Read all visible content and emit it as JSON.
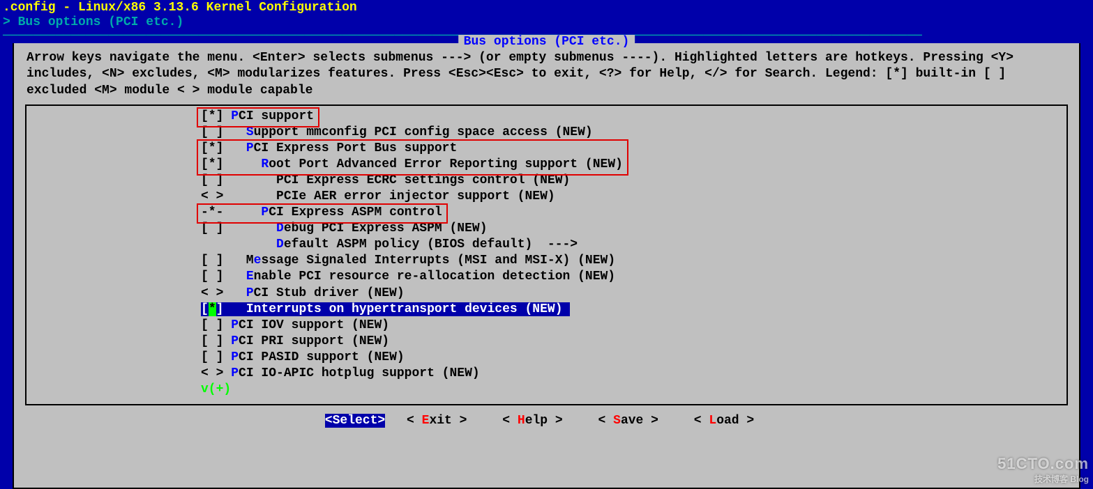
{
  "title": ".config - Linux/x86 3.13.6 Kernel Configuration",
  "breadcrumb_prefix": "> ",
  "breadcrumb": "Bus options (PCI etc.)",
  "panel_title": "Bus options (PCI etc.)",
  "help": "Arrow keys navigate the menu.  <Enter> selects submenus ---> (or empty submenus ----).  Highlighted letters are hotkeys.  Pressing <Y> includes, <N> excludes, <M> modularizes features.  Press <Esc><Esc> to exit, <?> for Help, </> for Search.  Legend: [*] built-in  [ ] excluded  <M> module  < > module capable",
  "items": [
    {
      "indent": 0,
      "marker": "[*]",
      "hotkey": "P",
      "before": "",
      "after": "CI support",
      "highlight": false,
      "box": "a"
    },
    {
      "indent": 0,
      "marker": "[ ]",
      "hotkey": "S",
      "before": "  ",
      "after": "upport mmconfig PCI config space access (NEW)",
      "highlight": false,
      "box": null
    },
    {
      "indent": 0,
      "marker": "[*]",
      "hotkey": "P",
      "before": "  ",
      "after": "CI Express Port Bus support",
      "highlight": false,
      "box": "b"
    },
    {
      "indent": 0,
      "marker": "[*]",
      "hotkey": "R",
      "before": "    ",
      "after": "oot Port Advanced Error Reporting support (NEW)",
      "highlight": false,
      "box": "b"
    },
    {
      "indent": 0,
      "marker": "[ ]",
      "hotkey": "",
      "before": "      ",
      "after": "PCI Express ECRC settings control (NEW)",
      "highlight": false,
      "box": null
    },
    {
      "indent": 0,
      "marker": "< >",
      "hotkey": "",
      "before": "      ",
      "after": "PCIe AER error injector support (NEW)",
      "highlight": false,
      "box": null
    },
    {
      "indent": 0,
      "marker": "-*-",
      "hotkey": "P",
      "before": "    ",
      "after": "CI Express ASPM control",
      "highlight": false,
      "box": "c"
    },
    {
      "indent": 0,
      "marker": "[ ]",
      "hotkey": "D",
      "before": "      ",
      "after": "ebug PCI Express ASPM (NEW)",
      "highlight": false,
      "box": null
    },
    {
      "indent": 0,
      "marker": "   ",
      "hotkey": "D",
      "before": "      ",
      "after": "efault ASPM policy (BIOS default)  --->",
      "highlight": false,
      "box": null
    },
    {
      "indent": 0,
      "marker": "[ ]",
      "hotkey": "e",
      "before": "  M",
      "after": "ssage Signaled Interrupts (MSI and MSI-X) (NEW)",
      "highlight": false,
      "box": null
    },
    {
      "indent": 0,
      "marker": "[ ]",
      "hotkey": "E",
      "before": "  ",
      "after": "nable PCI resource re-allocation detection (NEW)",
      "highlight": false,
      "box": null
    },
    {
      "indent": 0,
      "marker": "< >",
      "hotkey": "P",
      "before": "  ",
      "after": "CI Stub driver (NEW)",
      "highlight": false,
      "box": null
    },
    {
      "indent": 0,
      "marker": "[*]",
      "hotkey": "",
      "before": "  ",
      "after": "Interrupts on hypertransport devices (NEW)",
      "highlight": true,
      "box": null
    },
    {
      "indent": 0,
      "marker": "[ ]",
      "hotkey": "P",
      "before": "",
      "after": "CI IOV support (NEW)",
      "highlight": false,
      "box": null
    },
    {
      "indent": 0,
      "marker": "[ ]",
      "hotkey": "P",
      "before": "",
      "after": "CI PRI support (NEW)",
      "highlight": false,
      "box": null
    },
    {
      "indent": 0,
      "marker": "[ ]",
      "hotkey": "P",
      "before": "",
      "after": "CI PASID support (NEW)",
      "highlight": false,
      "box": null
    },
    {
      "indent": 0,
      "marker": "< >",
      "hotkey": "P",
      "before": "",
      "after": "CI IO-APIC hotplug support (NEW)",
      "highlight": false,
      "box": null
    }
  ],
  "scroll_indicator": "v(+)",
  "buttons": [
    {
      "label": "Select",
      "hotkey": "S",
      "active": true
    },
    {
      "label": "Exit",
      "hotkey": "E",
      "active": false
    },
    {
      "label": "Help",
      "hotkey": "H",
      "active": false
    },
    {
      "label": "Save",
      "hotkey": "S",
      "active": false
    },
    {
      "label": "Load",
      "hotkey": "L",
      "active": false
    }
  ],
  "watermark": {
    "main": "51CTO.com",
    "sub": "技术博客  Blog"
  }
}
